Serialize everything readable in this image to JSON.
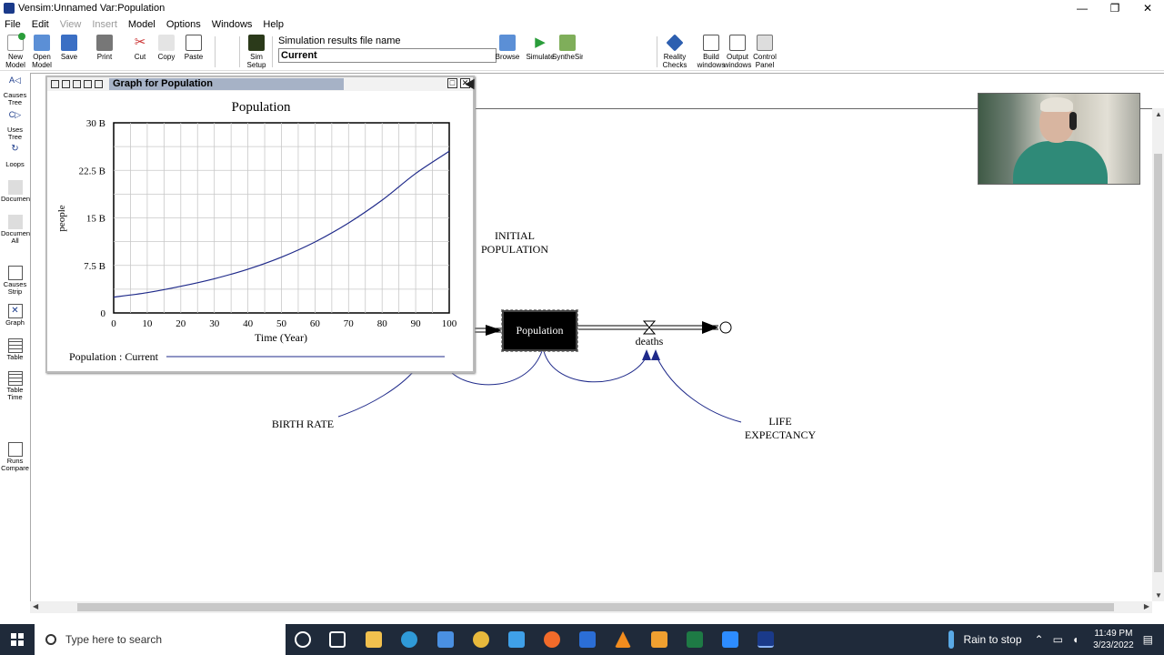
{
  "window": {
    "title": "Vensim:Unnamed Var:Population"
  },
  "window_controls": {
    "minimize": "—",
    "maximize": "❐",
    "close": "✕"
  },
  "menu": [
    "File",
    "Edit",
    "View",
    "Insert",
    "Model",
    "Options",
    "Windows",
    "Help"
  ],
  "toolbar": {
    "new_model": "New Model",
    "open_model": "Open Model",
    "save": "Save",
    "print": "Print",
    "cut": "Cut",
    "copy": "Copy",
    "paste": "Paste",
    "sim_setup": "Sim Setup",
    "sim_results_caption": "Simulation results file name",
    "sim_results_value": "Current",
    "browse": "Browse",
    "simulate": "Simulate",
    "synthesim": "SyntheSim",
    "reality_checks": "Reality Checks",
    "build_windows": "Build windows",
    "output_windows": "Output windows",
    "control_panel": "Control Panel"
  },
  "palette": {
    "causes_tree": "Causes Tree",
    "uses_tree": "Uses Tree",
    "loops": "Loops",
    "document": "Documen",
    "document_all": "Documen All",
    "causes_strip": "Causes Strip",
    "graph": "Graph",
    "table": "Table",
    "table_time": "Table Time",
    "runs_compare": "Runs Compare"
  },
  "diagram": {
    "stock_label": "Population",
    "initial_population": "INITIAL POPULATION",
    "birth_rate": "BIRTH RATE",
    "deaths": "deaths",
    "life_expectancy": "LIFE EXPECTANCY"
  },
  "graph_window": {
    "title": "Graph for Population",
    "legend_label": "Population : Current",
    "restore_btn": "□",
    "close_btn": "✕"
  },
  "chart_data": {
    "type": "line",
    "title": "Population",
    "xlabel": "Time (Year)",
    "ylabel": "people",
    "xlim": [
      0,
      100
    ],
    "ylim": [
      0,
      30000000000
    ],
    "x_ticks": [
      "0",
      "10",
      "20",
      "30",
      "40",
      "50",
      "60",
      "70",
      "80",
      "90",
      "100"
    ],
    "y_ticks": [
      "0",
      "7.5 B",
      "15 B",
      "22.5 B",
      "30 B"
    ],
    "grid": true,
    "legend_placement": "bottom",
    "series": [
      {
        "name": "Population : Current",
        "color": "#1f2a8a",
        "x": [
          0,
          10,
          20,
          30,
          40,
          50,
          60,
          70,
          80,
          90,
          100
        ],
        "values": [
          2500000000,
          3200000000,
          4200000000,
          5400000000,
          6900000000,
          8800000000,
          11200000000,
          14200000000,
          17800000000,
          22000000000,
          25500000000
        ]
      }
    ]
  },
  "taskbar": {
    "search_placeholder": "Type here to search",
    "weather": "Rain to stop",
    "time": "11:49 PM",
    "date": "3/23/2022"
  },
  "colors": {
    "accent": "#a6b2c6",
    "link_arrow": "#1f2a8a",
    "taskbar": "#1f2a3a"
  }
}
